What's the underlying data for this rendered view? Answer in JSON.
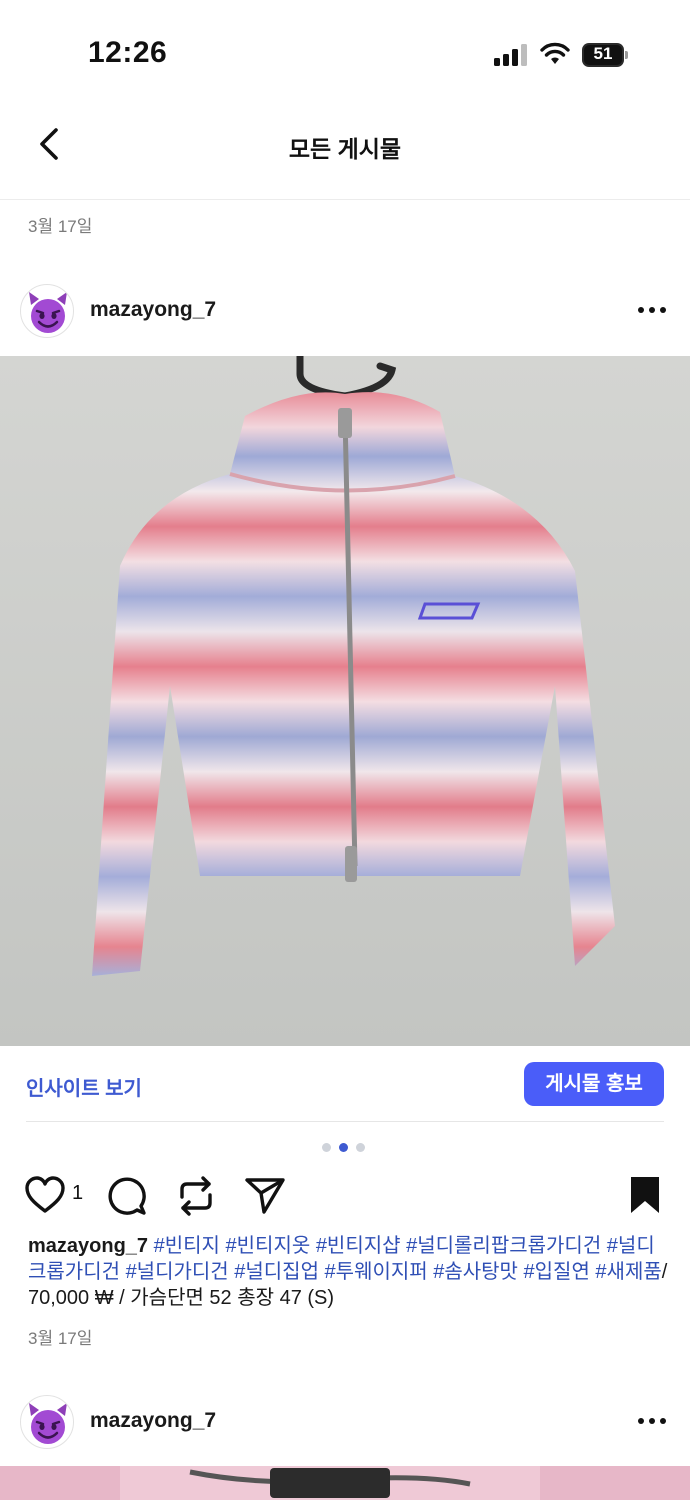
{
  "status_bar": {
    "time": "12:26",
    "battery": "51"
  },
  "nav": {
    "title": "모든 게시물",
    "back_icon": "chevron-left-icon"
  },
  "feed": {
    "date_header": "3월 17일"
  },
  "post": {
    "username": "mazayong_7",
    "avatar_icon": "smiling-devil-emoji",
    "photo_description_icon": "striped-knit-cardigan-photo",
    "insights_label": "인사이트 보기",
    "promote_label": "게시물 홍보",
    "carousel": {
      "count": 3,
      "active_index": 1
    },
    "like_count": "1",
    "caption": {
      "username": "mazayong_7",
      "tags": [
        "#빈티지",
        "#빈티지옷",
        "#빈티지샵",
        "#널디롤리팝크롭가디건",
        "#널디크롭가디건",
        "#널디가디건",
        "#널디집업",
        "#투웨이지퍼",
        "#솜사탕맛",
        "#입질연",
        "#새제품"
      ],
      "tail": "/ 70,000 ₩ / 가슴단면 52 총장 47 (S)"
    },
    "date": "3월 17일"
  },
  "next_post": {
    "username": "mazayong_7",
    "avatar_icon": "smiling-devil-emoji"
  },
  "colors": {
    "accent": "#4a5df9",
    "link": "#3e5ad1",
    "hashtag": "#2f4fb5"
  }
}
